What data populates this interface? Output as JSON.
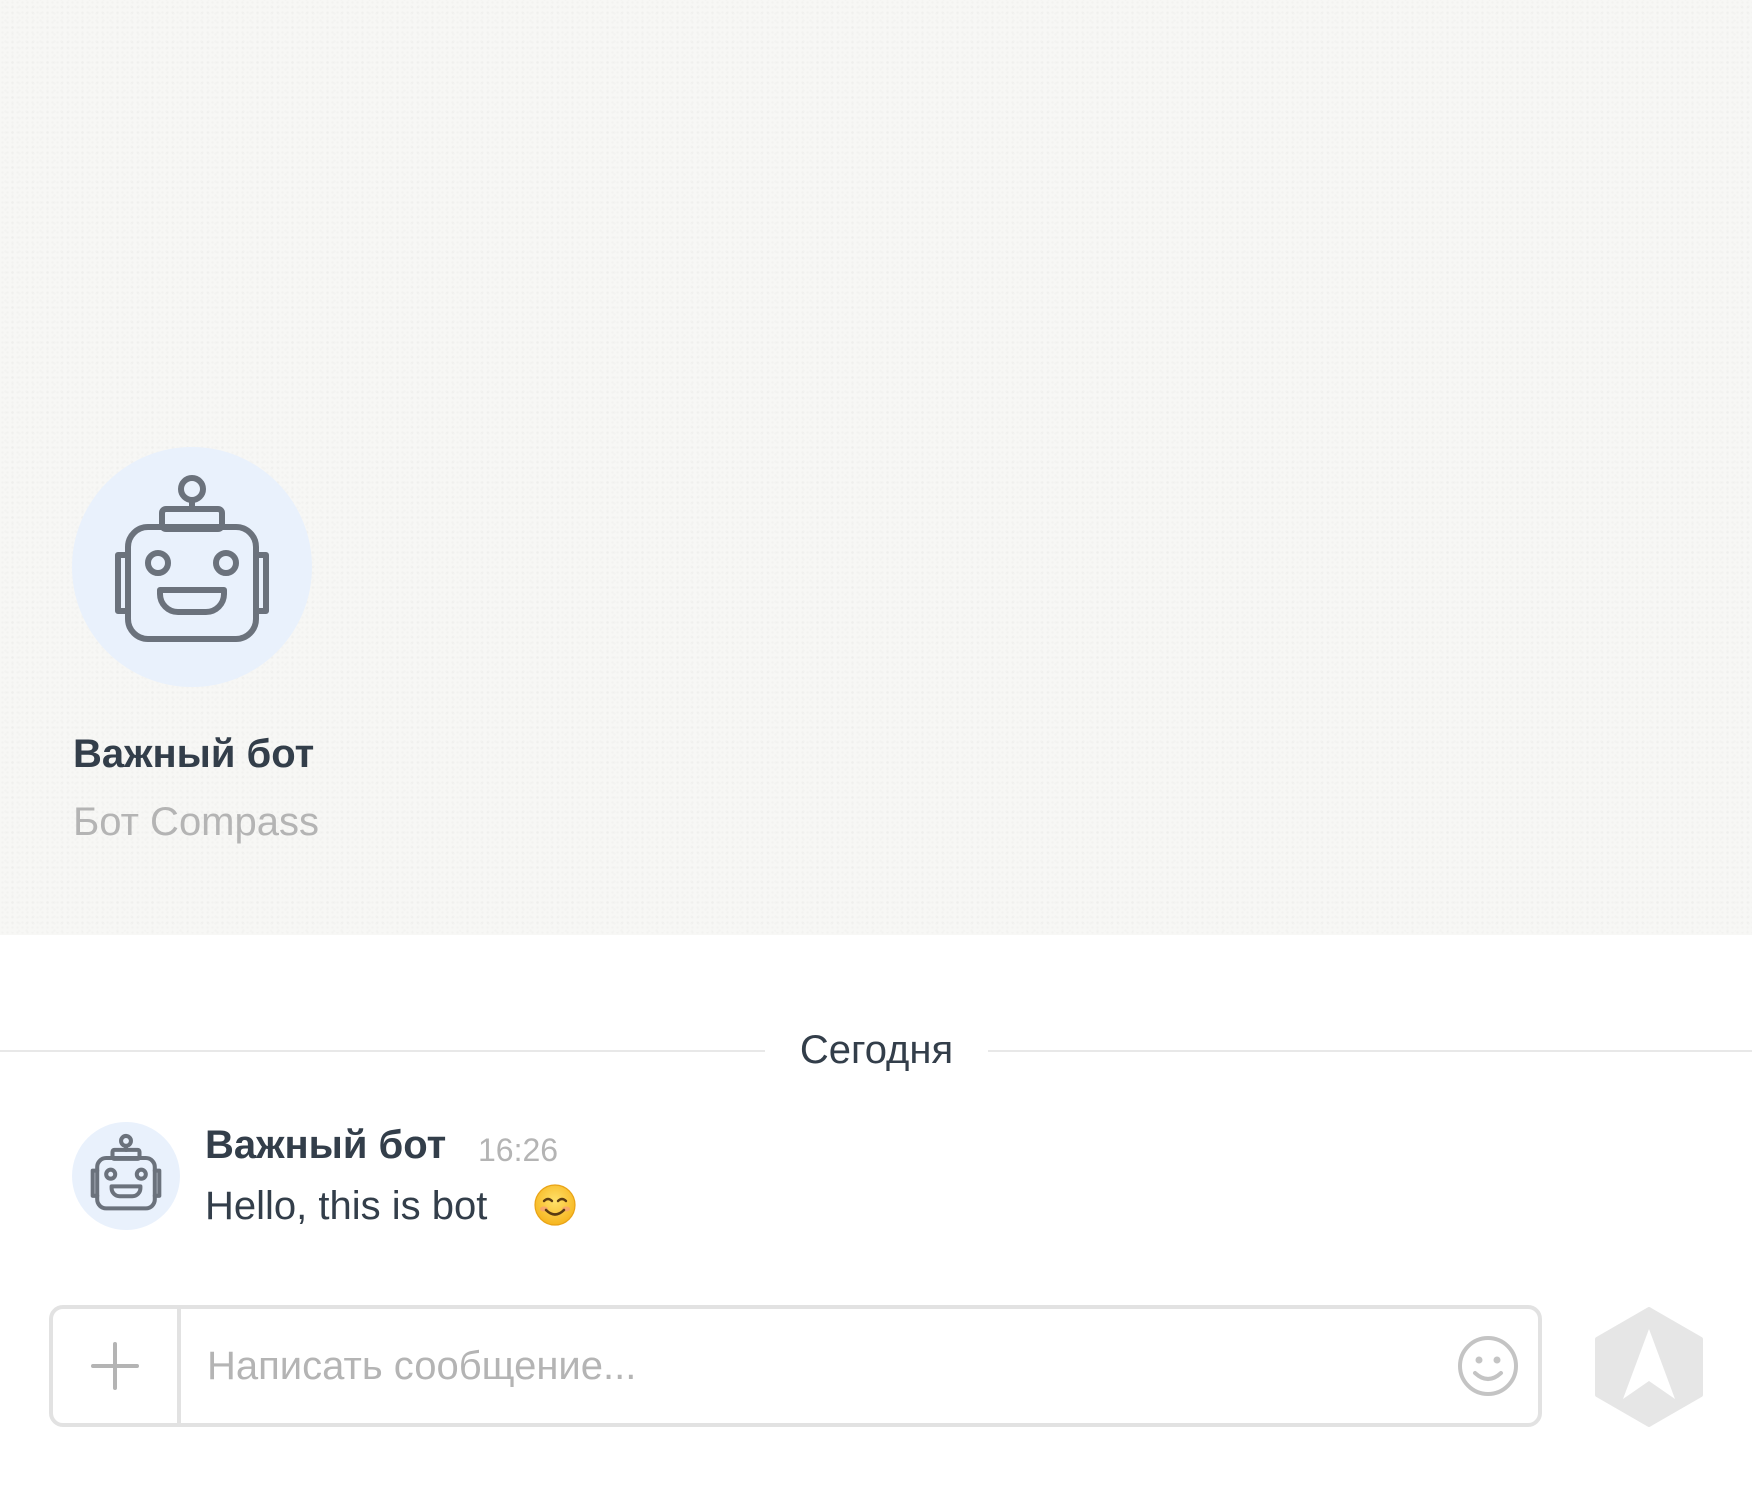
{
  "profile": {
    "name": "Важный бот",
    "subtitle": "Бот Compass"
  },
  "feed": {
    "date_divider": "Сегодня",
    "messages": [
      {
        "author": "Важный бот",
        "time": "16:26",
        "text": "Hello, this is bot",
        "emoji": "smiling-face-emoji"
      }
    ]
  },
  "composer": {
    "placeholder": "Написать сообщение...",
    "attach_icon": "plus-icon",
    "emoji_icon": "smiley-icon",
    "send_icon": "send-arrow-icon"
  },
  "colors": {
    "header_background": "#f7f7f5",
    "avatar_background": "#e9f1fc",
    "text_primary": "#333e4a",
    "text_secondary": "#b4b4b4",
    "border": "#e2e2e2",
    "send_button": "#e6e6e6"
  }
}
